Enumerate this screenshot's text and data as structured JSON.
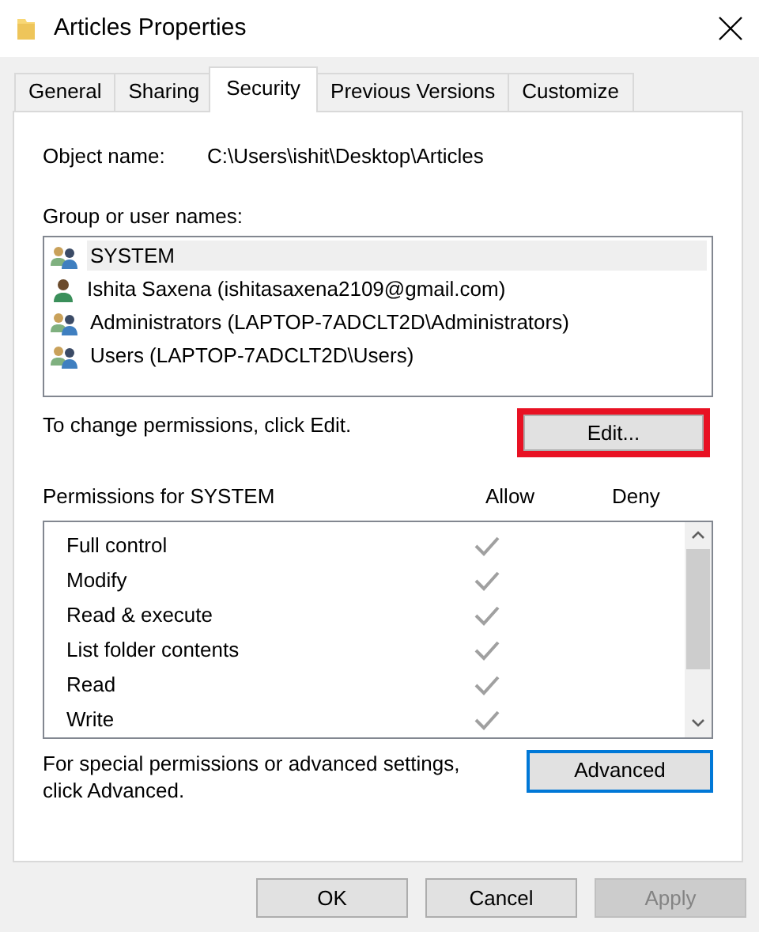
{
  "window": {
    "title": "Articles Properties"
  },
  "tabs": [
    {
      "label": "General",
      "selected": false
    },
    {
      "label": "Sharing",
      "selected": false
    },
    {
      "label": "Security",
      "selected": true
    },
    {
      "label": "Previous Versions",
      "selected": false
    },
    {
      "label": "Customize",
      "selected": false
    }
  ],
  "object_name": {
    "label": "Object name:",
    "value": "C:\\Users\\ishit\\Desktop\\Articles"
  },
  "users": {
    "label": "Group or user names:",
    "items": [
      {
        "name": "SYSTEM",
        "kind": "group",
        "selected": true
      },
      {
        "name": "Ishita Saxena (ishitasaxena2109@gmail.com)",
        "kind": "user",
        "selected": false
      },
      {
        "name": "Administrators (LAPTOP-7ADCLT2D\\Administrators)",
        "kind": "group",
        "selected": false
      },
      {
        "name": "Users (LAPTOP-7ADCLT2D\\Users)",
        "kind": "group",
        "selected": false
      }
    ]
  },
  "change_hint": "To change permissions, click Edit.",
  "edit_button": {
    "label": "Edit...",
    "highlighted": true
  },
  "permissions": {
    "label": "Permissions for SYSTEM",
    "columns": [
      "Allow",
      "Deny"
    ],
    "rows": [
      {
        "name": "Full control",
        "allow": true,
        "deny": false
      },
      {
        "name": "Modify",
        "allow": true,
        "deny": false
      },
      {
        "name": "Read & execute",
        "allow": true,
        "deny": false
      },
      {
        "name": "List folder contents",
        "allow": true,
        "deny": false
      },
      {
        "name": "Read",
        "allow": true,
        "deny": false
      },
      {
        "name": "Write",
        "allow": true,
        "deny": false
      }
    ]
  },
  "advanced_hint": "For special permissions or advanced settings, click Advanced.",
  "advanced_button": {
    "label": "Advanced",
    "focused": true
  },
  "footer_buttons": [
    {
      "label": "OK",
      "disabled": false
    },
    {
      "label": "Cancel",
      "disabled": false
    },
    {
      "label": "Apply",
      "disabled": true
    }
  ]
}
